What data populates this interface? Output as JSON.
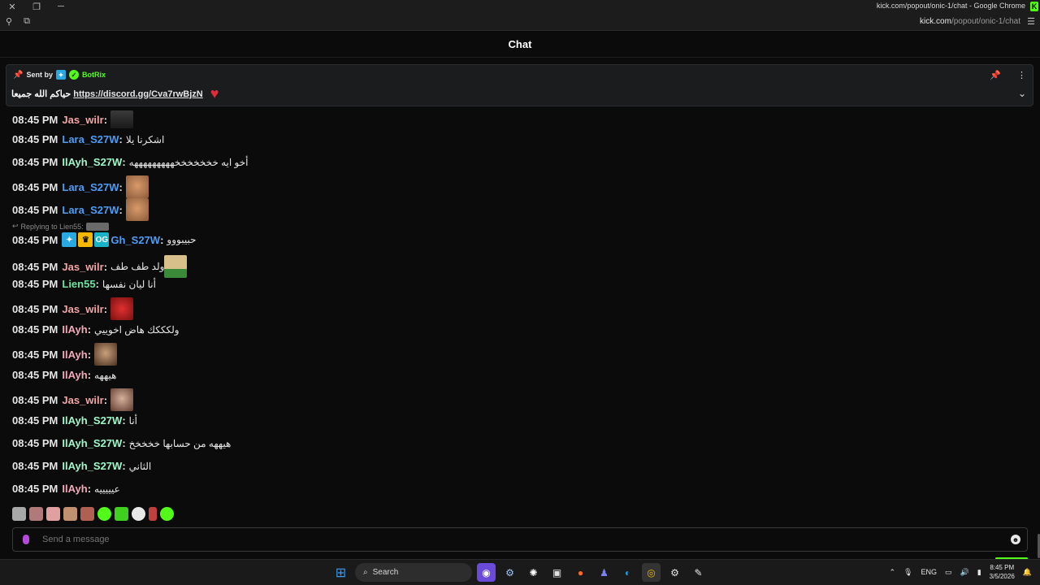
{
  "browser": {
    "title": "kick.com/popout/onic-1/chat - Google Chrome",
    "url_host": "kick.com",
    "url_path": "/popout/onic-1/chat"
  },
  "chat": {
    "header_title": "Chat"
  },
  "pinned": {
    "sent_by_label": "Sent by",
    "bot_name": "BotRix",
    "message_prefix": "حياكم الله جميعا",
    "link": "https://discord.gg/Cva7rwBjzN"
  },
  "messages": [
    {
      "time": "08:45 PM",
      "user": "Jas_wilr",
      "text": ""
    },
    {
      "time": "08:45 PM",
      "user": "Lara_S27W",
      "text": "اشكرنا يلا"
    },
    {
      "time": "08:45 PM",
      "user": "IlAyh_S27W",
      "text": "أخو ايه خخخخخخخهههههههههه"
    },
    {
      "time": "08:45 PM",
      "user": "Lara_S27W",
      "text": ""
    },
    {
      "time": "08:45 PM",
      "user": "Lara_S27W",
      "text": ""
    },
    {
      "time": "08:45 PM",
      "user": "Gh_S27W",
      "text": "حبيبووو",
      "reply_to": "Replying to Lien55:"
    },
    {
      "time": "08:45 PM",
      "user": "Jas_wilr",
      "text": "ولد طف طف"
    },
    {
      "time": "08:45 PM",
      "user": "Lien55",
      "text": "أنا ليان نفسها"
    },
    {
      "time": "08:45 PM",
      "user": "Jas_wilr",
      "text": ""
    },
    {
      "time": "08:45 PM",
      "user": "IlAyh",
      "text": "ولكككك هاض اخوييي"
    },
    {
      "time": "08:45 PM",
      "user": "IlAyh",
      "text": ""
    },
    {
      "time": "08:45 PM",
      "user": "IlAyh",
      "text": "هيههه"
    },
    {
      "time": "08:45 PM",
      "user": "Jas_wilr",
      "text": ""
    },
    {
      "time": "08:45 PM",
      "user": "IlAyh_S27W",
      "text": "أنا"
    },
    {
      "time": "08:45 PM",
      "user": "IlAyh_S27W",
      "text": "هيههه من حسابها خخخخخ"
    },
    {
      "time": "08:45 PM",
      "user": "IlAyh_S27W",
      "text": "الثاني"
    },
    {
      "time": "08:45 PM",
      "user": "IlAyh",
      "text": "عيييييه"
    }
  ],
  "composer": {
    "placeholder": "Send a message"
  },
  "taskbar": {
    "search_label": "Search",
    "lang": "ENG",
    "time": "8:45 PM",
    "date": "3/5/2026"
  }
}
